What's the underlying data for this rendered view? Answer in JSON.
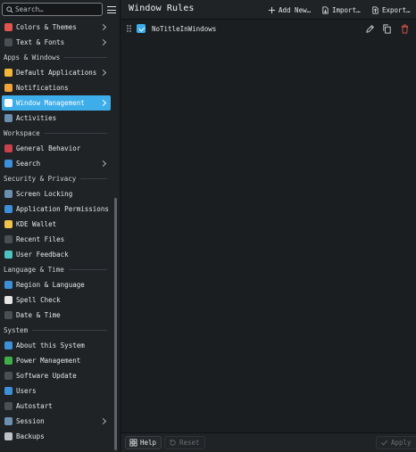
{
  "search": {
    "placeholder": "Search…"
  },
  "sidebar": {
    "sections": [
      {
        "header": "",
        "items": [
          {
            "label": "Colors & Themes",
            "icon": "palette-icon",
            "color": "#e0554f",
            "chevron": true
          },
          {
            "label": "Text & Fonts",
            "icon": "font-icon",
            "color": "#4a4f54",
            "chevron": true
          }
        ]
      },
      {
        "header": "Apps & Windows",
        "items": [
          {
            "label": "Default Applications",
            "icon": "star-icon",
            "color": "#f3b73a",
            "chevron": true
          },
          {
            "label": "Notifications",
            "icon": "bell-icon",
            "color": "#f2a33a",
            "chevron": false
          },
          {
            "label": "Window Management",
            "icon": "window-icon",
            "color": "#ffffff",
            "chevron": true,
            "selected": true
          },
          {
            "label": "Activities",
            "icon": "activities-icon",
            "color": "#6c8fb0",
            "chevron": false
          }
        ]
      },
      {
        "header": "Workspace",
        "items": [
          {
            "label": "General Behavior",
            "icon": "general-behavior-icon",
            "color": "#c7424b",
            "chevron": false
          },
          {
            "label": "Search",
            "icon": "search-globe-icon",
            "color": "#3d8fd8",
            "chevron": true
          }
        ]
      },
      {
        "header": "Security & Privacy",
        "items": [
          {
            "label": "Screen Locking",
            "icon": "screen-lock-icon",
            "color": "#6c8fb0",
            "chevron": false
          },
          {
            "label": "Application Permissions",
            "icon": "shield-icon",
            "color": "#3d8fd8",
            "chevron": false
          },
          {
            "label": "KDE Wallet",
            "icon": "wallet-icon",
            "color": "#f0c34a",
            "chevron": false
          },
          {
            "label": "Recent Files",
            "icon": "recent-files-icon",
            "color": "#4a4f54",
            "chevron": false
          },
          {
            "label": "User Feedback",
            "icon": "feedback-icon",
            "color": "#4fc3c0",
            "chevron": false
          }
        ]
      },
      {
        "header": "Language & Time",
        "items": [
          {
            "label": "Region & Language",
            "icon": "region-icon",
            "color": "#3d8fd8",
            "chevron": false
          },
          {
            "label": "Spell Check",
            "icon": "spell-check-icon",
            "color": "#e6e6e6",
            "chevron": false
          },
          {
            "label": "Date & Time",
            "icon": "clock-icon",
            "color": "#4a4f54",
            "chevron": false
          }
        ]
      },
      {
        "header": "System",
        "items": [
          {
            "label": "About this System",
            "icon": "info-icon",
            "color": "#3d8fd8",
            "chevron": false
          },
          {
            "label": "Power Management",
            "icon": "power-icon",
            "color": "#3fae49",
            "chevron": false
          },
          {
            "label": "Software Update",
            "icon": "update-icon",
            "color": "#4a4f54",
            "chevron": false
          },
          {
            "label": "Users",
            "icon": "users-icon",
            "color": "#3d8fd8",
            "chevron": false
          },
          {
            "label": "Autostart",
            "icon": "autostart-icon",
            "color": "#4a4f54",
            "chevron": false
          },
          {
            "label": "Session",
            "icon": "session-icon",
            "color": "#6c8fb0",
            "chevron": true
          },
          {
            "label": "Backups",
            "icon": "backups-icon",
            "color": "#bfc3c7",
            "chevron": false
          }
        ]
      }
    ]
  },
  "header": {
    "title": "Window Rules",
    "add_label": "Add New…",
    "import_label": "Import…",
    "export_label": "Export…"
  },
  "rules": [
    {
      "name": "NoTitleInWindows",
      "enabled": true
    }
  ],
  "footer": {
    "help_label": "Help",
    "reset_label": "Reset",
    "apply_label": "Apply"
  },
  "colors": {
    "accent": "#3daee9",
    "delete": "#e0554f",
    "background": "#1b1e20",
    "sidebar": "#202326"
  }
}
